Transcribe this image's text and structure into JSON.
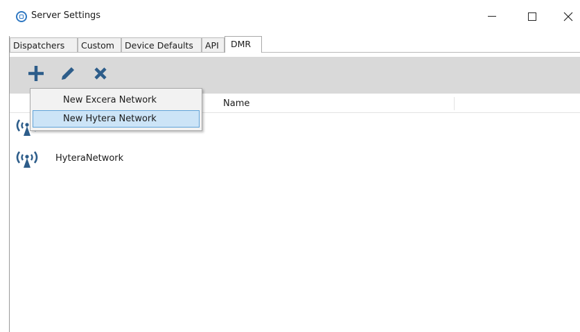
{
  "window": {
    "title": "Server Settings"
  },
  "tabs": [
    {
      "label": "Dispatchers",
      "active": false
    },
    {
      "label": "Custom",
      "active": false
    },
    {
      "label": "Device Defaults",
      "active": false
    },
    {
      "label": "API",
      "active": false
    },
    {
      "label": "DMR",
      "active": true
    }
  ],
  "toolbar": {
    "add_icon": "plus-icon",
    "edit_icon": "pencil-icon",
    "delete_icon": "x-icon",
    "accent_color": "#2d5d8a"
  },
  "list": {
    "columns": [
      "Name"
    ],
    "rows": [
      {
        "icon": "radio-tower-icon",
        "name": ""
      },
      {
        "icon": "radio-tower-icon",
        "name": "HyteraNetwork"
      }
    ]
  },
  "add_menu": {
    "items": [
      {
        "label": "New Excera Network",
        "highlighted": false
      },
      {
        "label": "New Hytera Network",
        "highlighted": true
      }
    ],
    "highlight_color": "#cce4f7"
  }
}
